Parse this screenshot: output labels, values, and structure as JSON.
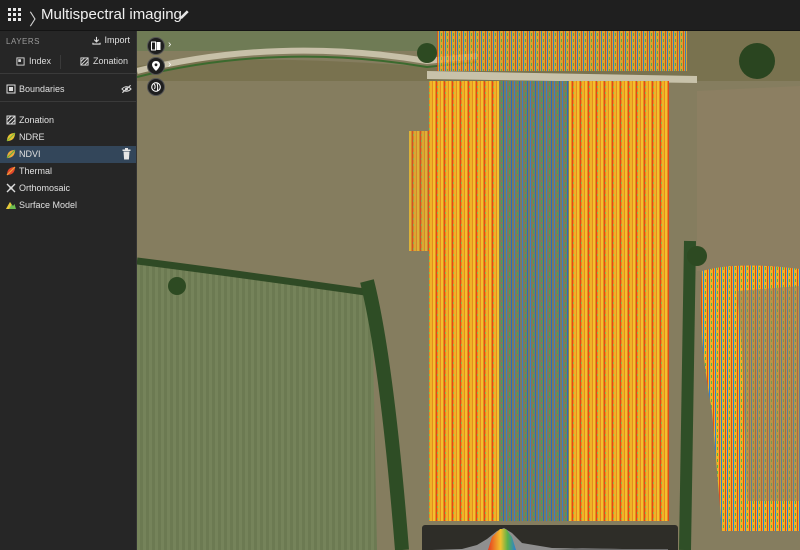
{
  "header": {
    "title": "Multispectral imaging"
  },
  "sidebar": {
    "layers_heading": "LAYERS",
    "import_label": "Import",
    "tabs": [
      {
        "label": "Index",
        "icon": "index-icon"
      },
      {
        "label": "Zonation",
        "icon": "zonation-icon"
      }
    ],
    "boundaries": {
      "label": "Boundaries",
      "icon": "boundaries-icon",
      "visibility_icon": "eye-off-icon"
    },
    "layers": [
      {
        "label": "Zonation",
        "icon": "zonation-icon",
        "selected": false
      },
      {
        "label": "NDRE",
        "icon": "ndre-leaf-icon",
        "selected": false
      },
      {
        "label": "NDVI",
        "icon": "ndvi-leaf-icon",
        "selected": true
      },
      {
        "label": "Thermal",
        "icon": "thermal-leaf-icon",
        "selected": false
      },
      {
        "label": "Orthomosaic",
        "icon": "orthomosaic-icon",
        "selected": false
      },
      {
        "label": "Surface Model",
        "icon": "surface-model-icon",
        "selected": false
      }
    ]
  },
  "map": {
    "controls": [
      "layers-compare-icon",
      "location-pin-icon",
      "globe-icon"
    ],
    "active_index": "NDVI"
  },
  "colors": {
    "accent_selected": "#33465a",
    "ndvi_low": "#e63a1e",
    "ndvi_mid": "#f2c12e",
    "ndvi_high": "#2b7fd6"
  }
}
